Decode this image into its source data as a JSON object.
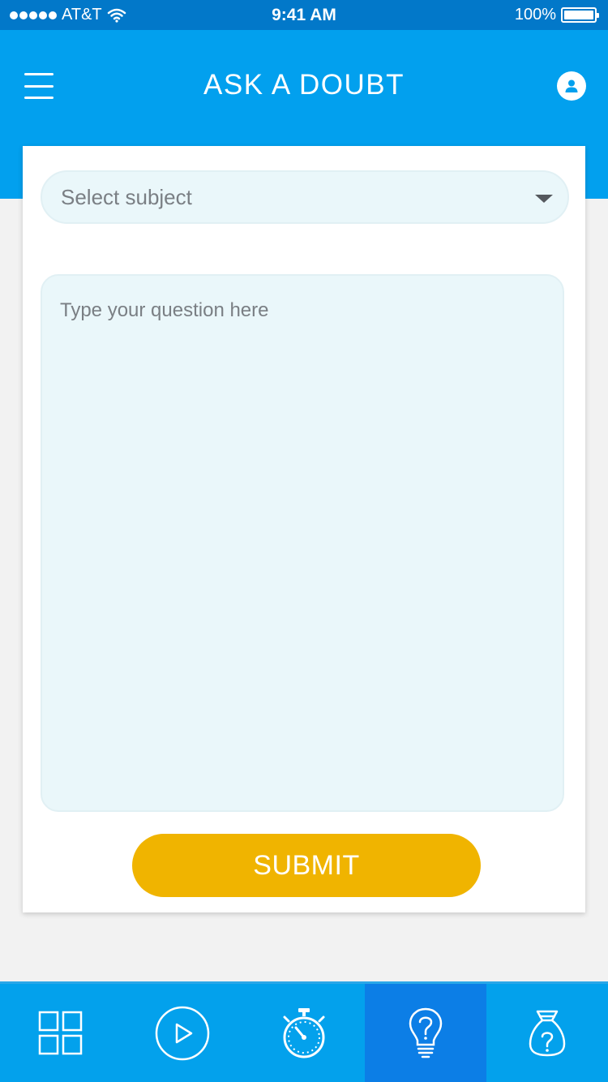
{
  "status_bar": {
    "carrier": "AT&T",
    "time": "9:41 AM",
    "battery": "100%"
  },
  "header": {
    "title": "ASK A DOUBT",
    "menu_icon": "hamburger-icon",
    "profile_icon": "user-icon"
  },
  "form": {
    "subject_placeholder": "Select subject",
    "question_placeholder": "Type your question here",
    "submit_label": "SUBMIT"
  },
  "tab_bar": {
    "tabs": [
      {
        "icon": "grid-icon",
        "active": false
      },
      {
        "icon": "play-icon",
        "active": false
      },
      {
        "icon": "stopwatch-icon",
        "active": false
      },
      {
        "icon": "lightbulb-question-icon",
        "active": true
      },
      {
        "icon": "question-bag-icon",
        "active": false
      }
    ]
  },
  "colors": {
    "header": "#02a0ee",
    "status_bar": "#0278c9",
    "submit": "#f0b400",
    "active_tab": "#0c7ee6",
    "field_bg": "#eaf7fa"
  }
}
